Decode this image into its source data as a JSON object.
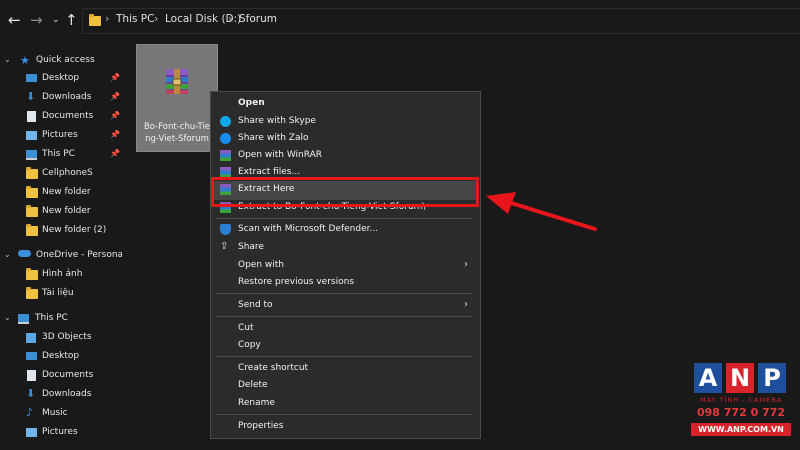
{
  "address_bar": {
    "crumbs": [
      "This PC",
      "Local Disk (D:)",
      "Sforum"
    ]
  },
  "sidebar": {
    "items": [
      {
        "label": "Quick access",
        "icon": "star-icon",
        "pinned": false
      },
      {
        "label": "Desktop",
        "icon": "desktop-icon",
        "pinned": true
      },
      {
        "label": "Downloads",
        "icon": "download-icon",
        "pinned": true
      },
      {
        "label": "Documents",
        "icon": "documents-icon",
        "pinned": true
      },
      {
        "label": "Pictures",
        "icon": "pictures-icon",
        "pinned": true
      },
      {
        "label": "This PC",
        "icon": "computer-icon",
        "pinned": true
      },
      {
        "label": "CellphoneS",
        "icon": "folder-icon",
        "pinned": false
      },
      {
        "label": "New folder",
        "icon": "folder-icon",
        "pinned": false
      },
      {
        "label": "New folder",
        "icon": "folder-icon",
        "pinned": false
      },
      {
        "label": "New folder (2)",
        "icon": "folder-icon",
        "pinned": false
      },
      {
        "label": "OneDrive - Personal",
        "icon": "cloud-icon",
        "pinned": false
      },
      {
        "label": "Hình ảnh",
        "icon": "folder-icon",
        "pinned": false
      },
      {
        "label": "Tài liệu",
        "icon": "folder-icon",
        "pinned": false
      },
      {
        "label": "This PC",
        "icon": "computer-icon",
        "pinned": false
      },
      {
        "label": "3D Objects",
        "icon": "cube-icon",
        "pinned": false
      },
      {
        "label": "Desktop",
        "icon": "desktop-icon",
        "pinned": false
      },
      {
        "label": "Documents",
        "icon": "documents-icon",
        "pinned": false
      },
      {
        "label": "Downloads",
        "icon": "download-icon",
        "pinned": false
      },
      {
        "label": "Music",
        "icon": "music-icon",
        "pinned": false
      },
      {
        "label": "Pictures",
        "icon": "pictures-icon",
        "pinned": false
      }
    ]
  },
  "file": {
    "name_line1": "Bo-Font-chu-Tie",
    "name_line2": "ng-Viet-Sforum"
  },
  "context_menu": {
    "items": [
      {
        "label": "Open",
        "bold": true
      },
      {
        "label": "Share with Skype"
      },
      {
        "label": "Share with Zalo"
      },
      {
        "label": "Open with WinRAR"
      },
      {
        "label": "Extract files..."
      },
      {
        "label": "Extract Here"
      },
      {
        "label": "Extract to Bo-Font-chu-Tieng-Viet-Sforum\\"
      },
      {
        "label": "Scan with Microsoft Defender..."
      },
      {
        "label": "Share"
      },
      {
        "label": "Open with"
      },
      {
        "label": "Restore previous versions"
      },
      {
        "label": "Send to"
      },
      {
        "label": "Cut"
      },
      {
        "label": "Copy"
      },
      {
        "label": "Create shortcut"
      },
      {
        "label": "Delete"
      },
      {
        "label": "Rename"
      },
      {
        "label": "Properties"
      }
    ]
  },
  "logo": {
    "letters": [
      "A",
      "N",
      "P"
    ],
    "tagline": "MÁY TÍNH - CAMERA",
    "phone": "098 772 0 772",
    "website": "WWW.ANP.COM.VN"
  },
  "colors": {
    "background": "#191919",
    "menu_bg": "#2b2b2b",
    "highlight_border": "#e8151b",
    "logo_blue": "#1d4f9c",
    "logo_red": "#d8232a"
  }
}
